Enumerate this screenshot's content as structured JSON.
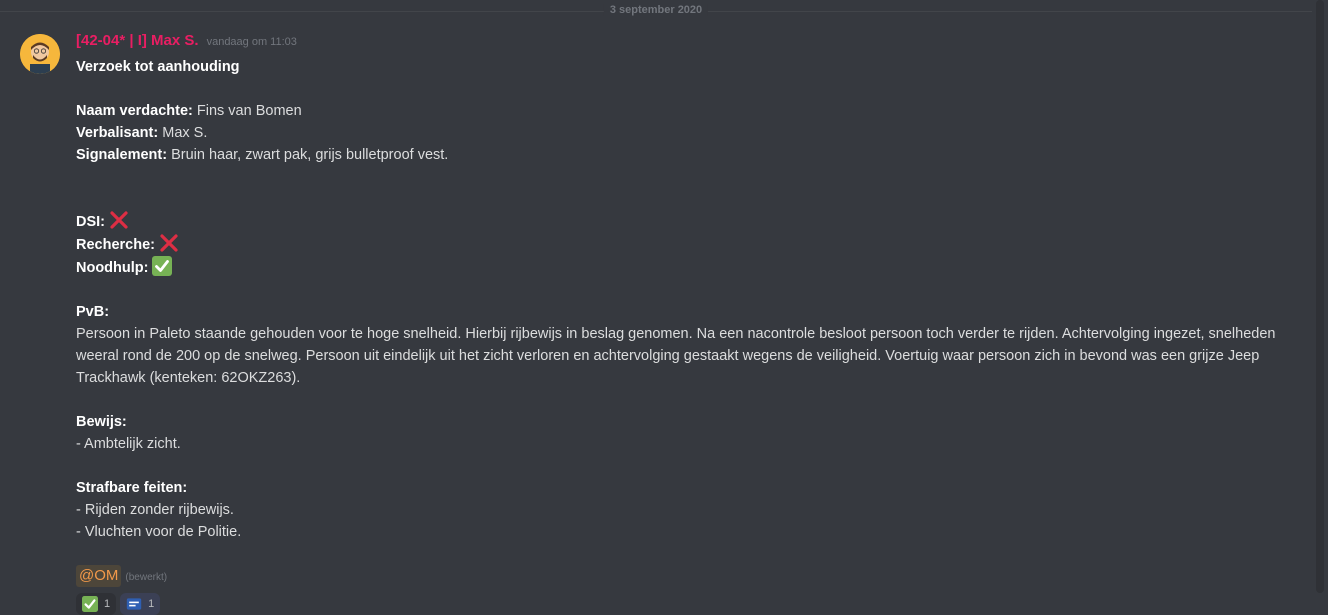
{
  "date_divider": "3 september 2020",
  "message": {
    "username": "[42-04* | I] Max S.",
    "timestamp": "vandaag om 11:03",
    "title": "Verzoek tot aanhouding",
    "suspect_label": "Naam verdachte:",
    "suspect_value": "Fins van Bomen",
    "officer_label": "Verbalisant:",
    "officer_value": "Max S.",
    "description_label": "Signalement:",
    "description_value": "Bruin haar, zwart pak, grijs bulletproof vest.",
    "dsi_label": "DSI:",
    "recherche_label": "Recherche:",
    "noodhulp_label": "Noodhulp:",
    "pvb_label": "PvB:",
    "pvb_text": "Persoon in Paleto staande gehouden voor te hoge snelheid. Hierbij rijbewijs in beslag genomen. Na een nacontrole besloot persoon toch verder te rijden. Achtervolging ingezet, snelheden weeral rond de 200 op de snelweg. Persoon uit eindelijk uit het zicht verloren en achtervolging gestaakt wegens de veiligheid. Voertuig waar persoon zich in bevond was een grijze Jeep Trackhawk (kenteken: 62OKZ263).",
    "bewijs_label": "Bewijs:",
    "bewijs_items": [
      "- Ambtelijk zicht."
    ],
    "feiten_label": "Strafbare feiten:",
    "feiten_items": [
      "- Rijden zonder rijbewijs.",
      "- Vluchten voor de Politie."
    ],
    "mention": "@OM",
    "edited": "(bewerkt)",
    "reactions": [
      {
        "icon": "check-icon",
        "count": "1"
      },
      {
        "icon": "custom-emoji-icon",
        "count": "1"
      }
    ]
  },
  "colors": {
    "background": "#36393f",
    "username": "#e91e63",
    "mention": "#f2994a"
  }
}
